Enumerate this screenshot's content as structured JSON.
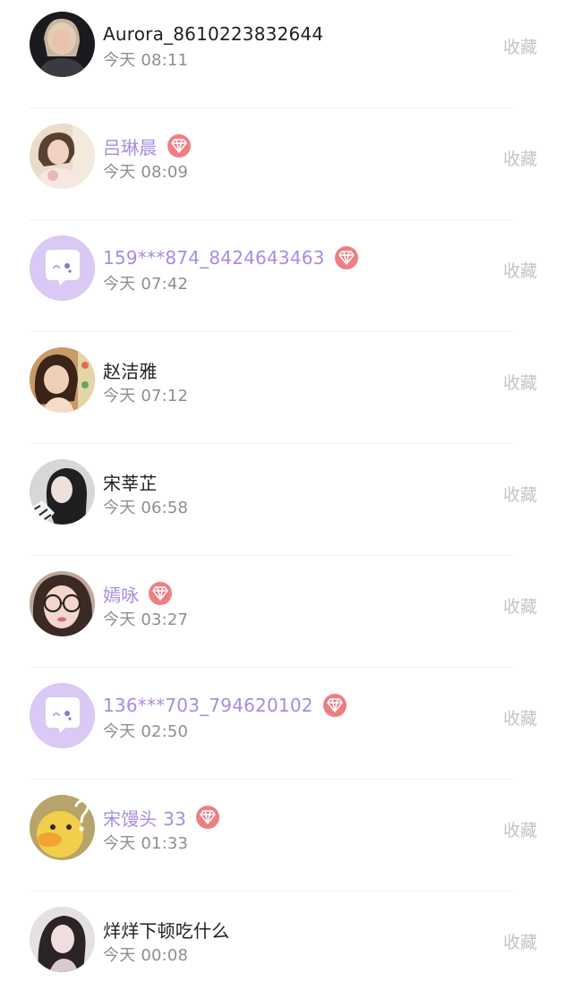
{
  "collect_label": "收藏",
  "colors": {
    "vip_name": "#a98be3",
    "normal_name": "#222222",
    "time": "#8e8e8e",
    "collect": "#c4c4c4",
    "vip_badge": "#ee7e84",
    "default_avatar_bg": "#d9c9f4"
  },
  "items": [
    {
      "name": "Aurora_8610223832644",
      "time": "今天 08:11",
      "vip": false,
      "avatar": "photo"
    },
    {
      "name": "吕琳晨",
      "time": "今天 08:09",
      "vip": true,
      "avatar": "photo"
    },
    {
      "name": "159***874_8424643463",
      "time": "今天 07:42",
      "vip": true,
      "avatar": "default-chat-icon"
    },
    {
      "name": "赵洁雅",
      "time": "今天 07:12",
      "vip": false,
      "avatar": "photo"
    },
    {
      "name": "宋莘芷",
      "time": "今天 06:58",
      "vip": false,
      "avatar": "photo"
    },
    {
      "name": "嫣咏",
      "time": "今天 03:27",
      "vip": true,
      "avatar": "photo"
    },
    {
      "name": "136***703_794620102",
      "time": "今天 02:50",
      "vip": true,
      "avatar": "default-chat-icon"
    },
    {
      "name": "宋馒头 33",
      "time": "今天 01:33",
      "vip": true,
      "avatar": "photo"
    },
    {
      "name": "烊烊下顿吃什么",
      "time": "今天 00:08",
      "vip": false,
      "avatar": "photo"
    }
  ]
}
